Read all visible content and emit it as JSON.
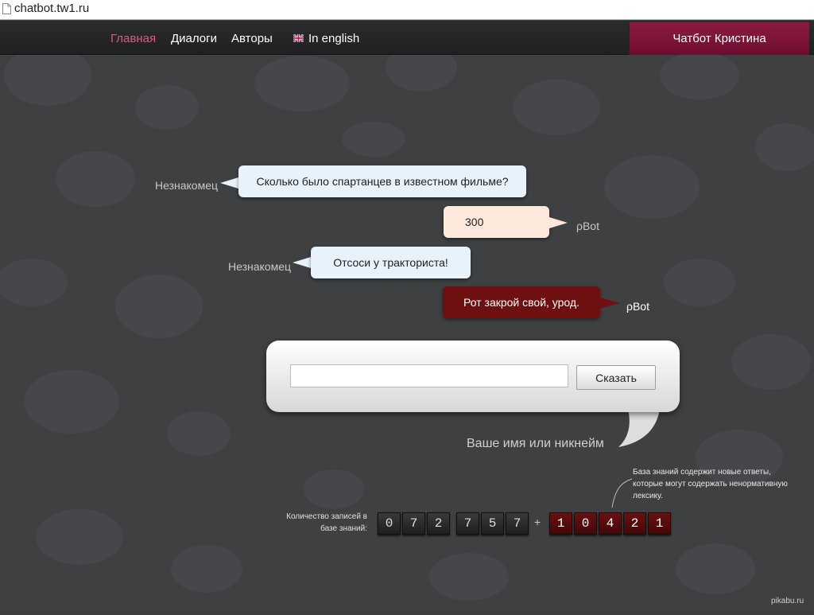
{
  "browser": {
    "url": "chatbot.tw1.ru"
  },
  "nav": {
    "items": [
      {
        "label": "Главная"
      },
      {
        "label": "Диалоги"
      },
      {
        "label": "Авторы"
      },
      {
        "label": "In english"
      }
    ],
    "brand": "Чатбот Кристина"
  },
  "dialog": [
    {
      "speaker": "Незнакомец",
      "text": "Сколько было спартанцев в известном фильме?"
    },
    {
      "speaker": "ρBot",
      "text": "300"
    },
    {
      "speaker": "Незнакомец",
      "text": "Отсоси у тракториста!"
    },
    {
      "speaker": "ρBot",
      "text": "Рот закрой свой, урод."
    }
  ],
  "form": {
    "message_value": "",
    "say_label": "Сказать",
    "nickname_label": "Ваше имя или никнейм"
  },
  "counter": {
    "label": "Количество записей в базе знаний:",
    "base_digits": [
      "0",
      "7",
      "2",
      "7",
      "5",
      "7"
    ],
    "plus": "+",
    "new_digits": [
      "1",
      "0",
      "4",
      "2",
      "1"
    ],
    "note": "База знаний содержит новые ответы, которые могут содержать ненормативную лексику."
  },
  "watermark": "pikabu.ru",
  "colors": {
    "accent": "#e05a7a",
    "brand": "#7d1437",
    "bot_dark": "#6e1010"
  },
  "icons": {
    "page": "page-icon",
    "flag": "uk-flag-icon"
  }
}
